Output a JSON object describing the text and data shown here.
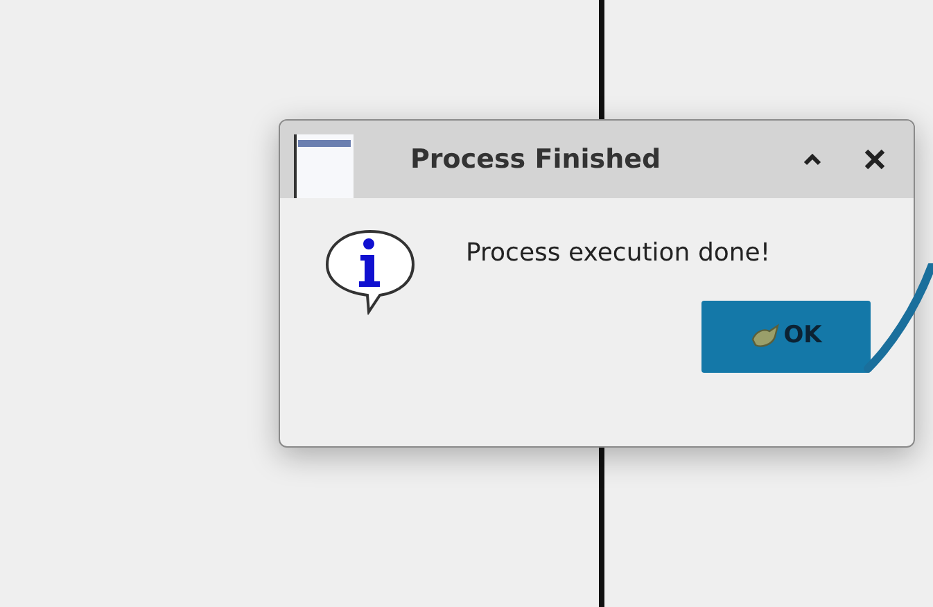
{
  "window": {
    "title": "Process Finished"
  },
  "message": "Process execution done!",
  "buttons": [
    {
      "label": "OK"
    }
  ]
}
